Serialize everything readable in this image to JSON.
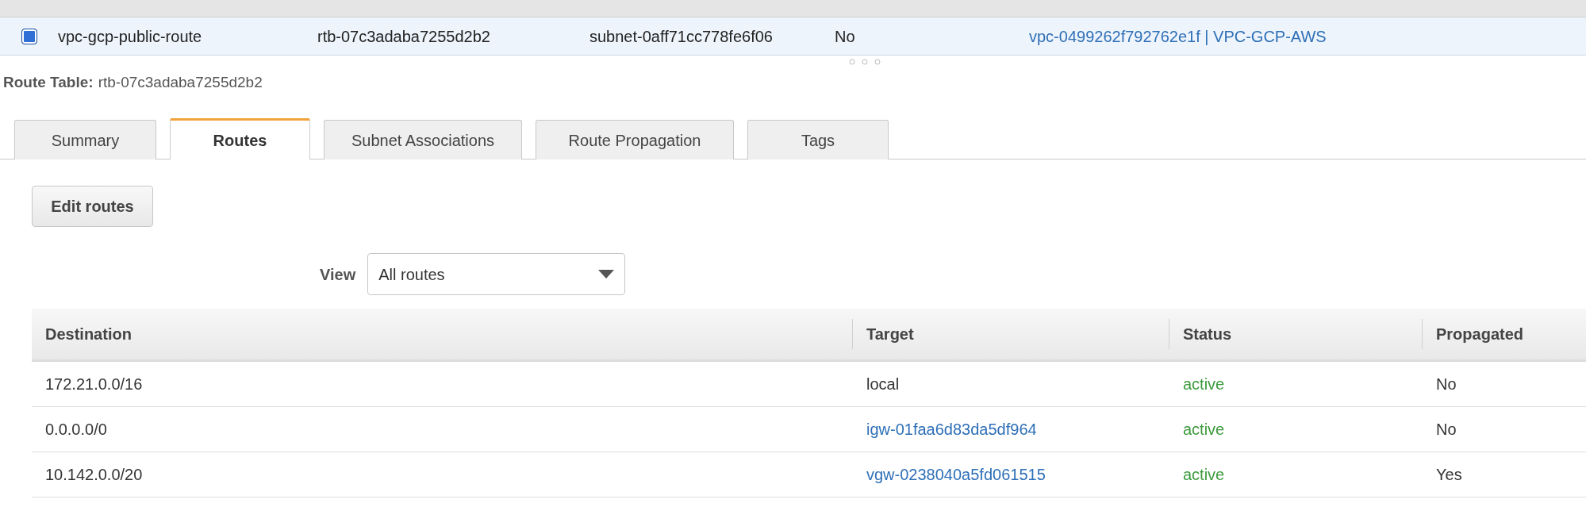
{
  "selected_row": {
    "selected": true,
    "cells": [
      {
        "text": "vpc-gcp-public-route",
        "kind": "text"
      },
      {
        "text": "rtb-07c3adaba7255d2b2",
        "kind": "text"
      },
      {
        "text": "subnet-0aff71cc778fe6f06",
        "kind": "text"
      },
      {
        "text": "No",
        "kind": "text"
      },
      {
        "text": "vpc-0499262f792762e1f | VPC-GCP-AWS",
        "kind": "link"
      }
    ]
  },
  "detail_heading": {
    "label": "Route Table:",
    "value": "rtb-07c3adaba7255d2b2"
  },
  "tabs": [
    {
      "label": "Summary",
      "selected": false
    },
    {
      "label": "Routes",
      "selected": true
    },
    {
      "label": "Subnet Associations",
      "selected": false
    },
    {
      "label": "Route Propagation",
      "selected": false
    },
    {
      "label": "Tags",
      "selected": false
    }
  ],
  "edit_button": "Edit routes",
  "view": {
    "label": "View",
    "value": "All routes"
  },
  "table": {
    "columns": [
      "Destination",
      "Target",
      "Status",
      "Propagated"
    ],
    "rows": [
      {
        "destination": "172.21.0.0/16",
        "target": "local",
        "kind": "text",
        "status": "active",
        "propagated": "No"
      },
      {
        "destination": "0.0.0.0/0",
        "target": "igw-01faa6d83da5df964",
        "kind": "link",
        "status": "active",
        "propagated": "No"
      },
      {
        "destination": "10.142.0.0/20",
        "target": "vgw-0238040a5fd061515",
        "kind": "link",
        "status": "active",
        "propagated": "Yes"
      }
    ]
  }
}
